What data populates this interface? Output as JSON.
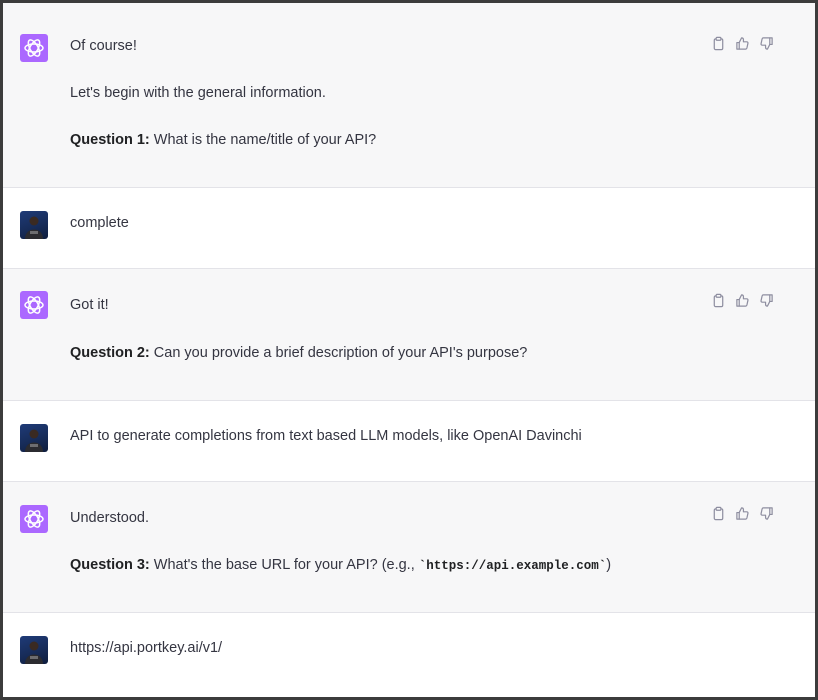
{
  "messages": [
    {
      "role": "assistant",
      "lines": [
        {
          "bold": "",
          "text": "Of course!"
        },
        {
          "bold": "",
          "text": "Let's begin with the general information."
        },
        {
          "bold": "Question 1:",
          "text": " What is the name/title of your API?"
        }
      ]
    },
    {
      "role": "user",
      "text": "complete"
    },
    {
      "role": "assistant",
      "lines": [
        {
          "bold": "",
          "text": "Got it!"
        },
        {
          "bold": "Question 2:",
          "text": " Can you provide a brief description of your API's purpose?"
        }
      ]
    },
    {
      "role": "user",
      "text": "API to generate completions from text based LLM models, like OpenAI Davinchi"
    },
    {
      "role": "assistant",
      "lines": [
        {
          "bold": "",
          "text": "Understood."
        },
        {
          "bold": "Question 3:",
          "text": " What's the base URL for your API? (e.g., ",
          "code": "`https://api.example.com`",
          "after": ")"
        }
      ]
    },
    {
      "role": "user",
      "text": "https://api.portkey.ai/v1/"
    }
  ],
  "icons": {
    "assistant_avatar": "openai-logo-icon",
    "user_avatar": "user-photo-avatar",
    "copy": "clipboard-icon",
    "like": "thumbs-up-icon",
    "dislike": "thumbs-down-icon"
  },
  "colors": {
    "assistant_bg": "#f7f7f8",
    "user_bg": "#ffffff",
    "bot_avatar": "#ab68ff",
    "text": "#343541",
    "icon": "#8e8ea0"
  }
}
